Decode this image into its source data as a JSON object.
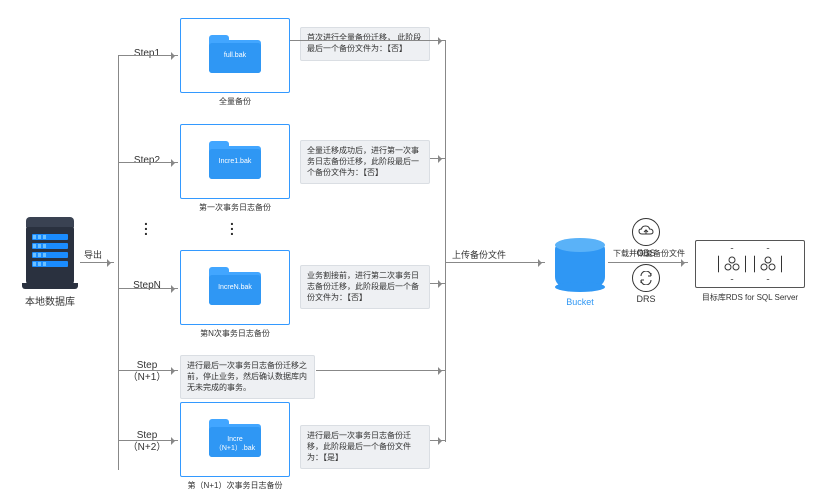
{
  "server": {
    "label": "本地数据库"
  },
  "edges": {
    "export": "导出",
    "upload": "上传备份文件",
    "download": "下载并恢复备份文件"
  },
  "steps": [
    {
      "label": "Step1",
      "file": "full.bak",
      "caption": "全量备份",
      "note": "首次进行全量备份迁移，\n此阶段最后一个备份文件为：【否】"
    },
    {
      "label": "Step2",
      "file": "Incre1.bak",
      "caption": "第一次事务日志备份",
      "note": "全量迁移成功后，进行第一次事务日志备份迁移，此阶段最后一个备份文件为：【否】"
    },
    {
      "label": "StepN",
      "file": "IncreN.bak",
      "caption": "第N次事务日志备份",
      "note": "业务割接前，进行第二次事务日志备份迁移，此阶段最后一个备份文件为：【否】"
    },
    {
      "label": "Step（N+1）",
      "file": "",
      "caption": "",
      "note": "进行最后一次事务日志备份迁移之前，停止业务，然后确认数据库内无未完成的事务。"
    },
    {
      "label": "Step（N+2）",
      "file": "Incre（N+1）.bak",
      "caption": "第（N+1）次事务日志备份",
      "note": "进行最后一次事务日志备份迁移，此阶段最后一个备份文件为：【是】"
    }
  ],
  "bucket": {
    "label": "Bucket"
  },
  "services": {
    "obs": "OBS",
    "drs": "DRS"
  },
  "target": {
    "label": "目标库RDS for SQL Server"
  }
}
